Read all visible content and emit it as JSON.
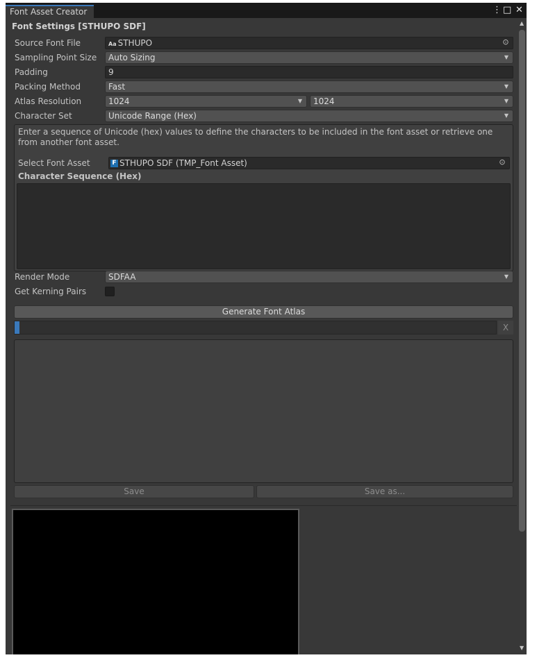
{
  "window": {
    "tab_title": "Font Asset Creator",
    "menu_glyph": "⋮",
    "maximize_glyph": "□",
    "close_glyph": "✕"
  },
  "section": {
    "header": "Font Settings [STHUPO SDF]"
  },
  "settings": {
    "source_font": {
      "label": "Source Font File",
      "badge": "Aa",
      "value": "STHUPO"
    },
    "sampling": {
      "label": "Sampling Point Size",
      "value": "Auto Sizing"
    },
    "padding": {
      "label": "Padding",
      "value": "9"
    },
    "packing": {
      "label": "Packing Method",
      "value": "Fast"
    },
    "atlas": {
      "label": "Atlas Resolution",
      "width": "1024",
      "height": "1024"
    },
    "charset": {
      "label": "Character Set",
      "value": "Unicode Range (Hex)"
    }
  },
  "charbox": {
    "help": "Enter a sequence of Unicode (hex) values to define the characters to be included in the font asset or retrieve one from another font asset.",
    "select_label": "Select Font Asset",
    "select_value": "STHUPO SDF (TMP_Font Asset)",
    "seq_label": "Character Sequence (Hex)",
    "seq_value": ""
  },
  "render": {
    "mode_label": "Render Mode",
    "mode_value": "SDFAA",
    "kerning_label": "Get Kerning Pairs",
    "kerning_checked": false
  },
  "generate": {
    "label": "Generate Font Atlas",
    "cancel": "X",
    "progress": 0.01
  },
  "save": {
    "save_label": "Save",
    "save_as_label": "Save as..."
  },
  "colors": {
    "panel": "#383838",
    "field": "#2a2a2a",
    "accent": "#3a79bb",
    "preview": "#000000"
  }
}
